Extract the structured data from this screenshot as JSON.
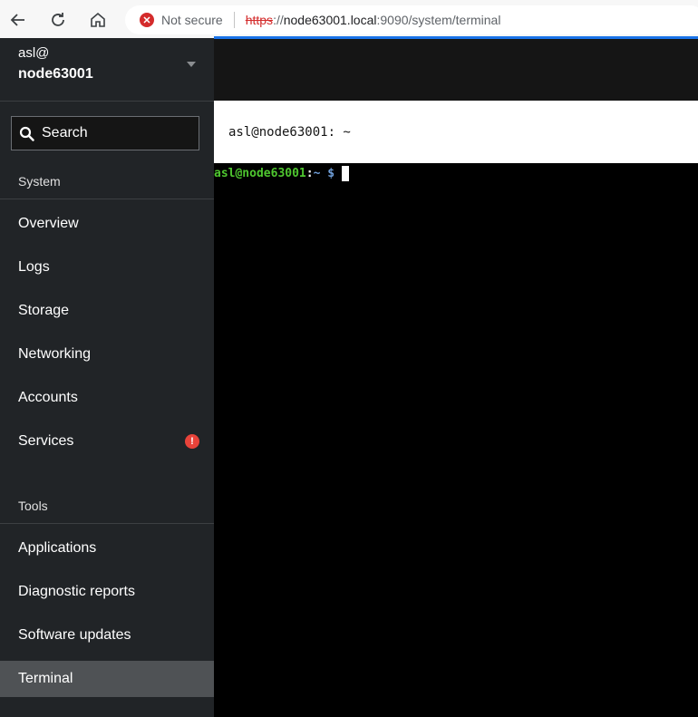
{
  "browser": {
    "security_label": "Not secure",
    "url_scheme": "https",
    "url_separator": "://",
    "url_host": "node63001.local",
    "url_rest": ":9090/system/terminal"
  },
  "host": {
    "user": "asl@",
    "name": "node63001"
  },
  "search": {
    "placeholder": "Search"
  },
  "sections": {
    "system": "System",
    "tools": "Tools"
  },
  "system_items": [
    {
      "label": "Overview"
    },
    {
      "label": "Logs"
    },
    {
      "label": "Storage"
    },
    {
      "label": "Networking"
    },
    {
      "label": "Accounts"
    },
    {
      "label": "Services",
      "badge": "!"
    }
  ],
  "tool_items": [
    {
      "label": "Applications"
    },
    {
      "label": "Diagnostic reports"
    },
    {
      "label": "Software updates"
    },
    {
      "label": "Terminal",
      "active": true
    }
  ],
  "terminal": {
    "title": "asl@node63001: ~",
    "prompt_user": "asl@node63001",
    "prompt_colon": ":",
    "prompt_dir": "~",
    "prompt_symbol": " $"
  },
  "colors": {
    "sidebar_bg": "#212427",
    "active_item": "#4f5255",
    "alert": "#e8433a",
    "prompt_user": "#4ec62f",
    "prompt_dir": "#6f9ed8"
  }
}
